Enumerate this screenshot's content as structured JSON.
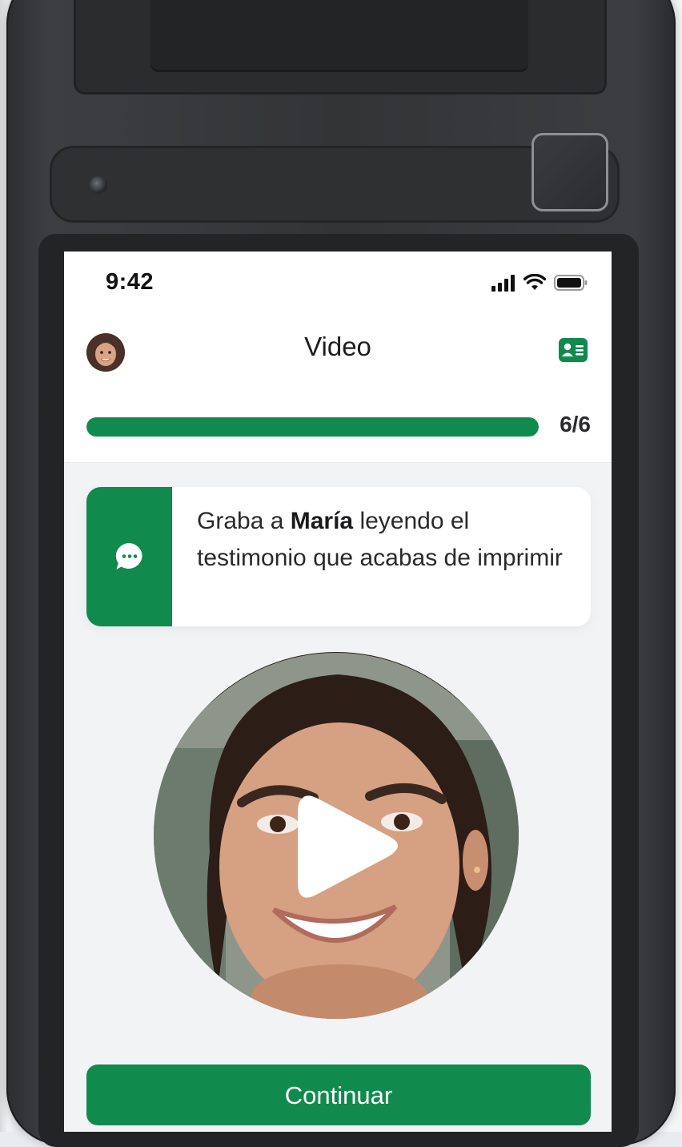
{
  "status_bar": {
    "time": "9:42",
    "icons": [
      "signal-icon",
      "wifi-icon",
      "battery-icon"
    ]
  },
  "header": {
    "title": "Video",
    "left_icon": "user-avatar",
    "right_icon": "id-card-icon"
  },
  "progress": {
    "label": "6/6",
    "current": 6,
    "total": 6,
    "fraction": 1.0
  },
  "instruction": {
    "icon": "chat-bubble-icon",
    "text_before": "Graba a ",
    "name": "María",
    "text_after": " leyendo el testimonio que acabas de imprimir"
  },
  "video_preview": {
    "icon": "play-icon"
  },
  "actions": {
    "continue_label": "Continuar"
  },
  "colors": {
    "brand_green": "#118a4e",
    "screen_background": "#f1f3f5",
    "panel_background": "#ffffff",
    "text_dark": "#1d1d1f"
  }
}
